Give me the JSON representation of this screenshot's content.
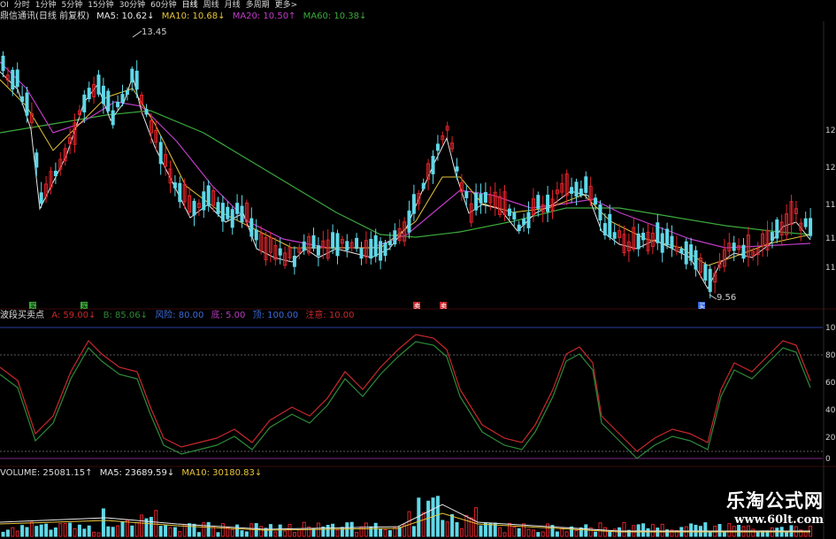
{
  "toolbar": {
    "items": [
      "OI",
      "分时",
      "1分钟",
      "5分钟",
      "15分钟",
      "30分钟",
      "60分钟",
      "日线",
      "周线",
      "月线",
      "多周期",
      "更多>"
    ]
  },
  "main_legend": {
    "stock": "鼎信通讯(日线 前复权)",
    "ma5": "MA5: 10.62↓",
    "ma10": "MA10: 10.68↓",
    "ma20": "MA20: 10.50↑",
    "ma60": "MA60: 10.38↓"
  },
  "price_annotations": {
    "high": "13.45",
    "low": "9.56"
  },
  "right_axis_ticks": [
    "12",
    "12",
    "11",
    "11",
    "11"
  ],
  "signal_markers": [
    "买",
    "买",
    "卖",
    "卖",
    "买"
  ],
  "indicator_legend": {
    "name": "波段买卖点",
    "a": "A: 59.00↓",
    "b": "B: 85.06↓",
    "risk": "风险: 80.00",
    "bottom": "底: 5.00",
    "top": "顶: 100.00",
    "attention": "注意: 10.00"
  },
  "indicator_axis_ticks": [
    "10",
    "80",
    "60",
    "40",
    "20",
    "0"
  ],
  "volume_legend": {
    "volume": "VOLUME: 25081.15↑",
    "ma5": "MA5: 23689.59↓",
    "ma10": "MA10: 30180.83↓"
  },
  "watermark": {
    "title": "乐淘公式网",
    "url": "www.60lt.com"
  },
  "colors": {
    "up": "#e0252b",
    "down": "#5fd8e8",
    "ma5": "#e8e8e8",
    "ma10": "#e8c43a",
    "ma20": "#c03cc8",
    "ma60": "#3caa3c",
    "line_a": "#c8282c",
    "line_b": "#2e8a3a"
  }
}
